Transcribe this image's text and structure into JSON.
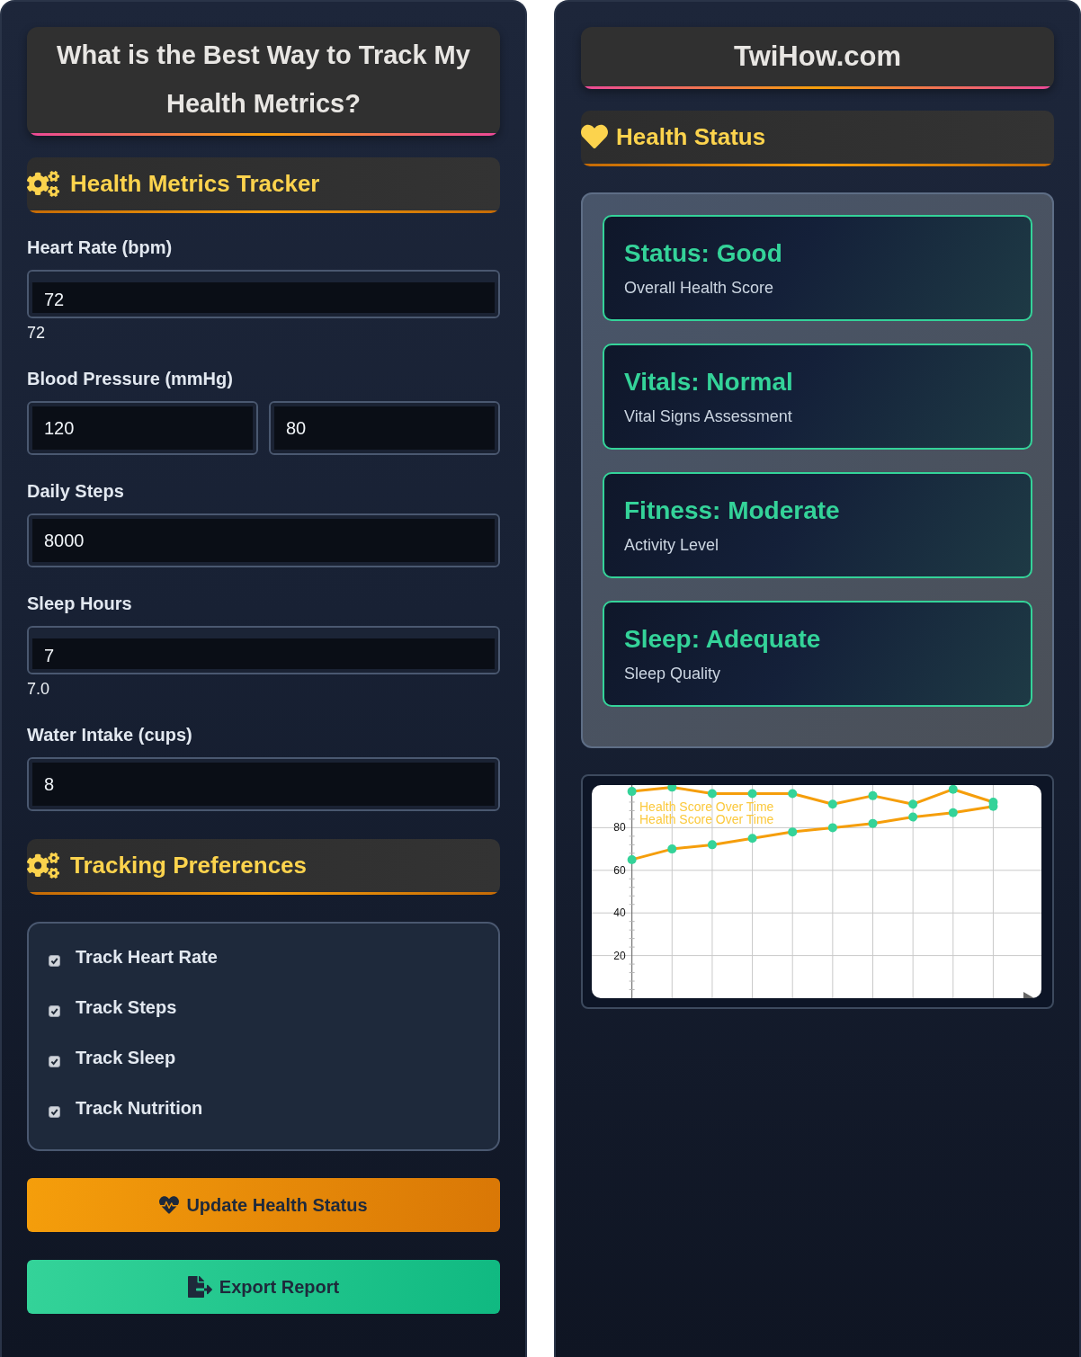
{
  "left": {
    "title": "What is the Best Way to Track My Health Metrics?",
    "tracker": {
      "heading": "Health Metrics Tracker",
      "fields": [
        {
          "kind": "reading",
          "label": "Heart Rate (bpm)",
          "value": "72",
          "reading": "72"
        },
        {
          "kind": "pair",
          "label": "Blood Pressure (mmHg)",
          "values": [
            "120",
            "80"
          ]
        },
        {
          "kind": "plain",
          "label": "Daily Steps",
          "value": "8000"
        },
        {
          "kind": "reading",
          "label": "Sleep Hours",
          "value": "7",
          "reading": "7.0"
        },
        {
          "kind": "plain",
          "label": "Water Intake (cups)",
          "value": "8"
        }
      ]
    },
    "preferences": {
      "heading": "Tracking Preferences",
      "options": [
        {
          "label": "Track Heart Rate",
          "checked": true
        },
        {
          "label": "Track Steps",
          "checked": true
        },
        {
          "label": "Track Sleep",
          "checked": true
        },
        {
          "label": "Track Nutrition",
          "checked": true
        }
      ]
    },
    "buttons": [
      {
        "kind": "update",
        "label": "Update Health Status"
      },
      {
        "kind": "export",
        "label": "Export Report"
      }
    ]
  },
  "right": {
    "site_title": "TwiHow.com",
    "status": {
      "heading": "Health Status",
      "cards": [
        {
          "title": "Status: Good",
          "subtitle": "Overall Health Score"
        },
        {
          "title": "Vitals: Normal",
          "subtitle": "Vital Signs Assessment"
        },
        {
          "title": "Fitness: Moderate",
          "subtitle": "Activity Level"
        },
        {
          "title": "Sleep: Adequate",
          "subtitle": "Sleep Quality"
        }
      ]
    },
    "chart": {
      "chart_data": {
        "type": "line",
        "categories": [
          null,
          null,
          null,
          null,
          null,
          null,
          null,
          null,
          null,
          null
        ],
        "series": [
          {
            "color": "#f59e0b",
            "marker": "circle",
            "values": [
              97,
              99,
              96,
              96,
              96,
              91,
              95,
              91,
              98,
              92
            ]
          },
          {
            "color": "#f59e0b",
            "marker": "circle",
            "values": [
              65,
              70,
              72,
              75,
              78,
              80,
              82,
              85,
              87,
              90
            ]
          }
        ],
        "ylim": [
          0,
          100
        ],
        "yticks": [
          20,
          40,
          60,
          80
        ],
        "grid": true,
        "annotations": [
          "Health Score Over Time",
          "Health Score Over Time"
        ]
      }
    }
  }
}
